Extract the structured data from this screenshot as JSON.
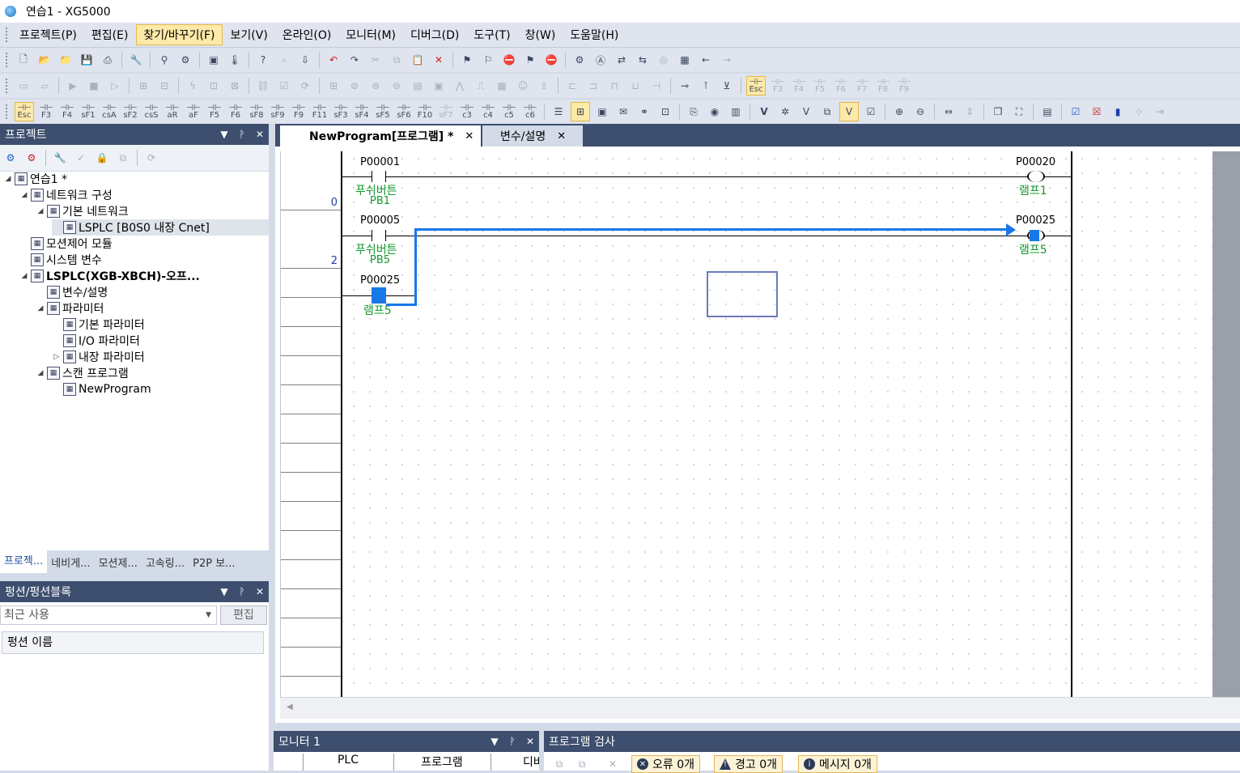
{
  "window": {
    "title": "연습1 - XG5000"
  },
  "menu": [
    "프로젝트(P)",
    "편집(E)",
    "찾기/바꾸기(F)",
    "보기(V)",
    "온라인(O)",
    "모니터(M)",
    "디버그(D)",
    "도구(T)",
    "창(W)",
    "도움말(H)"
  ],
  "menu_active_index": 2,
  "toolbar": {
    "row1_icons": [
      "new-file-icon",
      "open-folder-icon",
      "open-project-icon",
      "save-icon",
      "print-icon",
      "wrench-icon",
      "connect-icon",
      "disconnect-icon",
      "monitor-start-icon",
      "thermometer-icon",
      "help-icon",
      "find-icon",
      "download-icon",
      "undo-icon",
      "redo-icon",
      "cut-icon",
      "copy-icon",
      "paste-icon",
      "delete-icon",
      "mark-icon",
      "mark-clear-icon",
      "mark-stop-icon",
      "flag-icon",
      "flag-stop-icon",
      "settings-icon",
      "zoom-find-icon",
      "swap-icon",
      "replace-icon",
      "circle-icon",
      "grid-icon",
      "back-arrow-icon",
      "forward-arrow-icon"
    ],
    "row3_keys": [
      "Esc",
      "F3",
      "F4",
      "sF1",
      "csA",
      "sF2",
      "csS",
      "aR",
      "aF",
      "F5",
      "F6",
      "sF8",
      "sF9",
      "F9",
      "F11",
      "sF3",
      "sF4",
      "sF5",
      "sF6",
      "F10",
      "sF7",
      "c3",
      "c4",
      "c5",
      "c6"
    ],
    "row2_keys": [
      "Esc",
      "F3",
      "F4",
      "F5",
      "F6",
      "F7",
      "F8",
      "F9"
    ]
  },
  "project_panel": {
    "title": "프로젝트",
    "tree": [
      {
        "label": "연습1 *",
        "level": 0,
        "expand": "◢"
      },
      {
        "label": "네트워크 구성",
        "level": 1,
        "expand": "◢"
      },
      {
        "label": "기본 네트워크",
        "level": 2,
        "expand": "◢"
      },
      {
        "label": "LSPLC [B0S0 내장 Cnet]",
        "level": 3,
        "expand": "",
        "selected": true
      },
      {
        "label": "모션제어 모듈",
        "level": 1,
        "expand": ""
      },
      {
        "label": "시스템 변수",
        "level": 1,
        "expand": ""
      },
      {
        "label": "LSPLC(XGB-XBCH)-오프...",
        "level": 1,
        "expand": "◢",
        "bold": true
      },
      {
        "label": "변수/설명",
        "level": 2,
        "expand": ""
      },
      {
        "label": "파라미터",
        "level": 2,
        "expand": "◢"
      },
      {
        "label": "기본 파라미터",
        "level": 3,
        "expand": ""
      },
      {
        "label": "I/O 파라미터",
        "level": 3,
        "expand": ""
      },
      {
        "label": "내장 파라미터",
        "level": 3,
        "expand": "▷"
      },
      {
        "label": "스캔 프로그램",
        "level": 2,
        "expand": "◢"
      },
      {
        "label": "NewProgram",
        "level": 3,
        "expand": ""
      }
    ],
    "tabs": [
      "프로젝...",
      "네비게...",
      "모션제...",
      "고속링...",
      "P2P 보..."
    ]
  },
  "function_panel": {
    "title": "펑션/펑션블록",
    "combo_value": "최근 사용",
    "edit_button": "편집",
    "column_header": "펑션 이름"
  },
  "editor": {
    "tabs": [
      {
        "label": "NewProgram[프로그램] *",
        "active": true
      },
      {
        "label": "변수/설명",
        "active": false
      }
    ],
    "step_numbers": [
      "0",
      "2"
    ],
    "contacts": [
      {
        "address": "P00001",
        "comment": "푸쉬버튼",
        "name": "PB1"
      },
      {
        "address": "P00005",
        "comment": "푸쉬버튼",
        "name": "PB5"
      },
      {
        "address": "P00025",
        "comment": "램프5",
        "name": ""
      }
    ],
    "coils": [
      {
        "address": "P00020",
        "comment": "램프1"
      },
      {
        "address": "P00025",
        "comment": "램프5"
      }
    ]
  },
  "monitor_panel": {
    "title": "모니터 1",
    "columns": [
      "PLC",
      "프로그램",
      "디바"
    ]
  },
  "check_panel": {
    "title": "프로그램 검사",
    "error": "오류 0개",
    "warning": "경고 0개",
    "message": "메시지 0개"
  }
}
